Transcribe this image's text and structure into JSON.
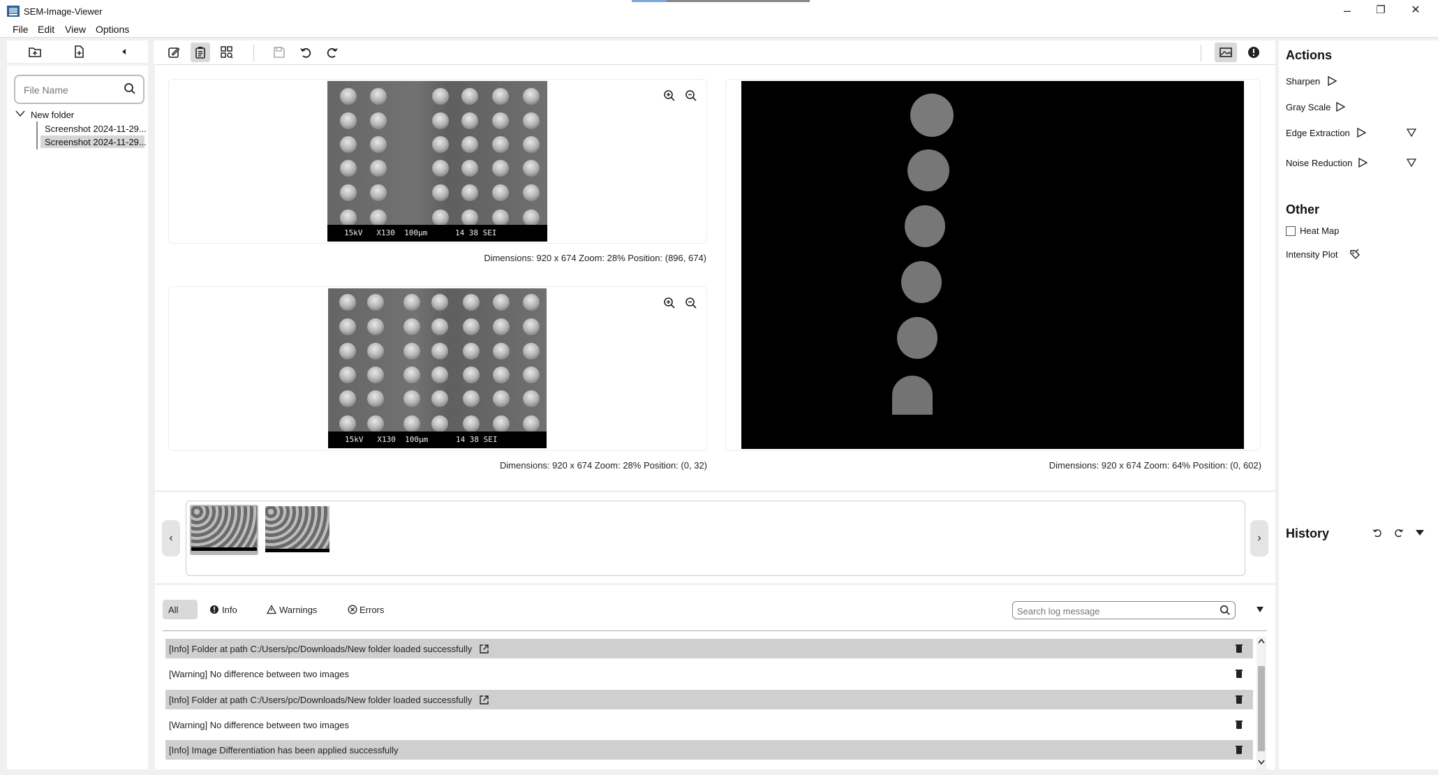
{
  "window": {
    "title": "SEM-Image-Viewer",
    "controls": {
      "minimize": "–",
      "maximize": "❐",
      "close": "✕"
    }
  },
  "menu": [
    "File",
    "Edit",
    "View",
    "Options"
  ],
  "sidebar": {
    "search_placeholder": "File Name",
    "folder": "New folder",
    "files": [
      "Screenshot 2024-11-29...",
      "Screenshot 2024-11-29..."
    ],
    "selected_index": 1
  },
  "toolbar_icons": {
    "left": [
      "open-folder-icon",
      "open-file-icon",
      "collapse-left-icon"
    ],
    "main": [
      "edit-icon",
      "clipboard-icon",
      "grid-view-icon",
      "save-icon",
      "undo-icon",
      "redo-icon"
    ],
    "right": [
      "image-compare-icon",
      "alert-icon"
    ]
  },
  "images": {
    "top_left": {
      "overlay": "15kV   X130  100μm      14 38 SEI",
      "dims": "Dimensions: 920 x 674  Zoom: 28%  Position: (896, 674)"
    },
    "bottom_left": {
      "overlay": "15kV   X130  100μm      14 38 SEI",
      "dims": "Dimensions: 920 x 674  Zoom: 28%  Position: (0, 32)"
    },
    "right": {
      "dims": "Dimensions: 920 x 674  Zoom: 64%  Position: (0, 602)"
    }
  },
  "thumbnails": {
    "count": 2,
    "prev": "‹",
    "next": "›"
  },
  "logs": {
    "filters": [
      "All",
      "Info",
      "Warnings",
      "Errors"
    ],
    "active_filter": "All",
    "search_placeholder": "Search log message",
    "entries": [
      {
        "text": "[Info] Folder at path C:/Users/pc/Downloads/New folder loaded successfully",
        "link": true,
        "shaded": true
      },
      {
        "text": "[Warning] No difference between two images",
        "link": false,
        "shaded": false
      },
      {
        "text": "[Info] Folder at path C:/Users/pc/Downloads/New folder loaded successfully",
        "link": true,
        "shaded": true
      },
      {
        "text": "[Warning] No difference between two images",
        "link": false,
        "shaded": false
      },
      {
        "text": "[Info] Image Differentiation has been applied successfully",
        "link": false,
        "shaded": true
      }
    ]
  },
  "actions": {
    "heading": "Actions",
    "items": [
      "Sharpen",
      "Gray Scale",
      "Edge Extraction",
      "Noise Reduction"
    ]
  },
  "other": {
    "heading": "Other",
    "heat_map": "Heat Map",
    "heat_map_checked": false,
    "intensity_plot": "Intensity Plot"
  },
  "history": {
    "heading": "History"
  }
}
